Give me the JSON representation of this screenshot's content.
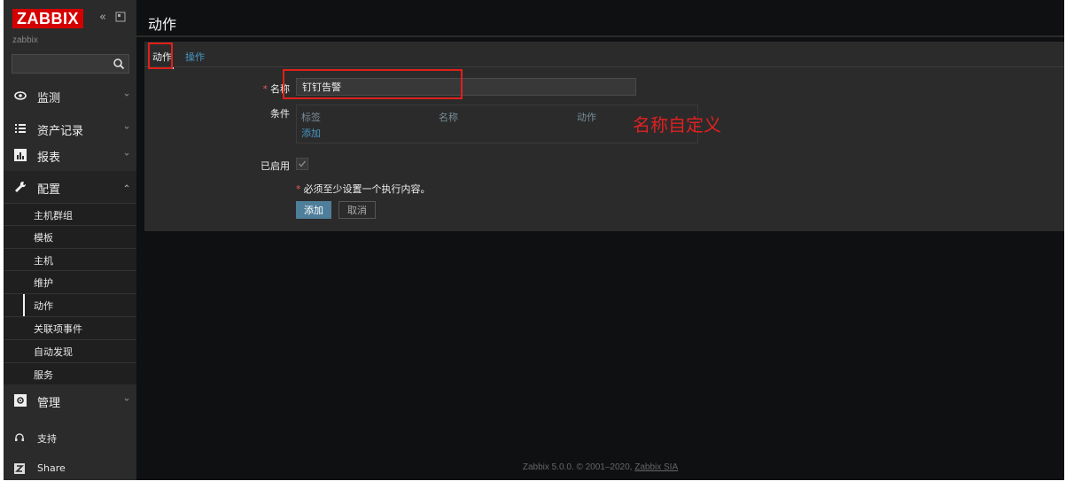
{
  "sidebar": {
    "logo": "ZABBIX",
    "server_name": "zabbix",
    "search_placeholder": "",
    "menu": [
      {
        "label": "监测",
        "icon": "eye-icon"
      },
      {
        "label": "资产记录",
        "icon": "list-icon"
      },
      {
        "label": "报表",
        "icon": "bar-chart-icon"
      },
      {
        "label": "配置",
        "icon": "wrench-icon"
      },
      {
        "label": "管理",
        "icon": "gear-icon"
      }
    ],
    "submenu": [
      "主机群组",
      "模板",
      "主机",
      "维护",
      "动作",
      "关联项事件",
      "自动发现",
      "服务"
    ],
    "footer": [
      {
        "label": "支持",
        "icon": "headset-icon"
      },
      {
        "label": "Share",
        "icon": "zabbix-share-icon"
      }
    ]
  },
  "header": {
    "title": "动作"
  },
  "tabs": [
    "动作",
    "操作"
  ],
  "form": {
    "name_label": "名称",
    "name_value": "钉钉告警",
    "conditions_label": "条件",
    "cond_headers": [
      "标签",
      "名称",
      "动作"
    ],
    "cond_add": "添加",
    "enabled_label": "已启用",
    "enabled": true,
    "warning": "必须至少设置一个执行内容。",
    "add_button": "添加",
    "cancel_button": "取消"
  },
  "annotation": {
    "text": "名称自定义"
  },
  "footer": {
    "prefix": "Zabbix 5.0.0. © 2001–2020, ",
    "link": "Zabbix SIA"
  }
}
